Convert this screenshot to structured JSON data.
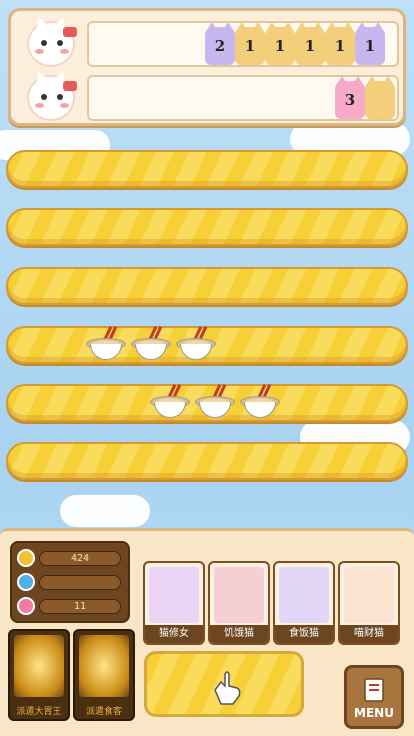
{
  "queue": {
    "row1_counts": [
      "2",
      "1",
      "1",
      "1",
      "1",
      "1"
    ],
    "row2_count": "3"
  },
  "stats": {
    "coins": "424",
    "gems": "",
    "hearts": "11"
  },
  "cats": [
    {
      "label": "猫修女"
    },
    {
      "label": "饥饿猫"
    },
    {
      "label": "食饭猫"
    },
    {
      "label": "喵财猫"
    }
  ],
  "skills": [
    {
      "label": "派遣大胃王"
    },
    {
      "label": "派遣食客"
    }
  ],
  "menu": {
    "label": "MENU"
  },
  "colors": {
    "lane_yellow": "#f7cf37",
    "panel_brown": "#6d4620"
  },
  "icons": [
    "coin-icon",
    "gem-icon",
    "heart-icon",
    "hand-pointer-icon",
    "menu-book-icon",
    "noodle-bowl-icon"
  ]
}
